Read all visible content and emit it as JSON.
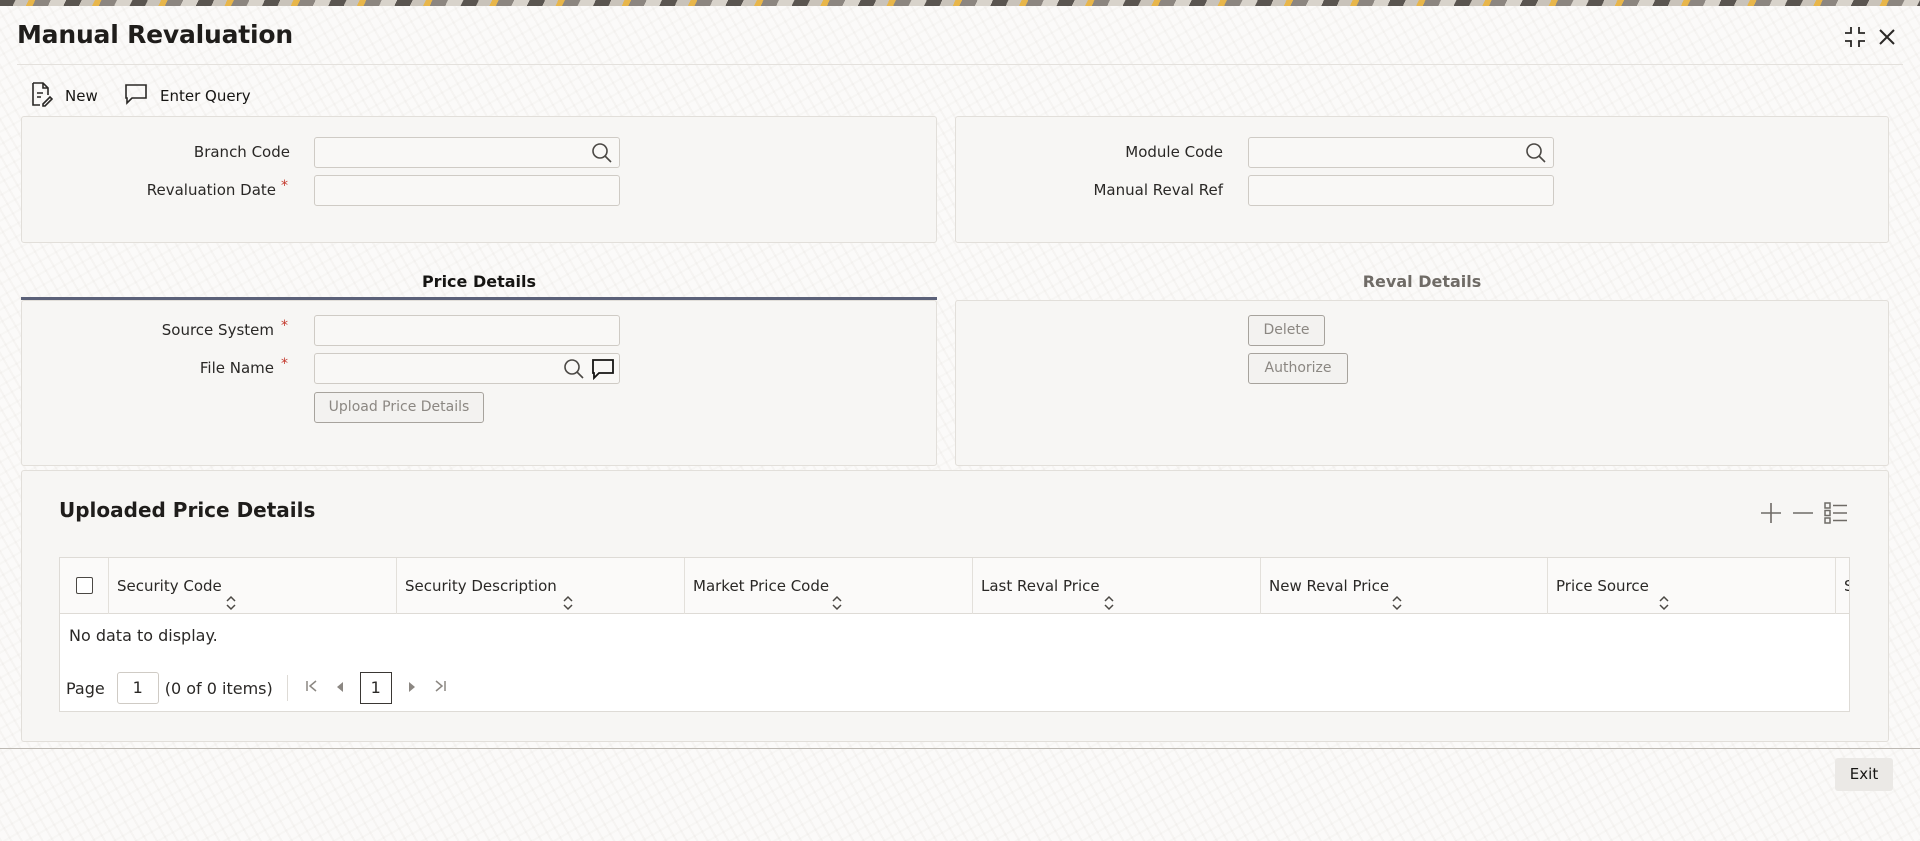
{
  "window": {
    "title": "Manual Revaluation"
  },
  "toolbar": {
    "new_label": "New",
    "enter_query_label": "Enter Query"
  },
  "header_panel": {
    "branch_code_label": "Branch Code",
    "branch_code_value": "",
    "revaluation_date_label": "Revaluation Date",
    "revaluation_date_value": "",
    "module_code_label": "Module Code",
    "module_code_value": "",
    "manual_reval_ref_label": "Manual Reval Ref",
    "manual_reval_ref_value": "",
    "required_marker": "*"
  },
  "tabs": [
    {
      "label": "Price Details",
      "active": true
    },
    {
      "label": "Reval Details",
      "active": false
    }
  ],
  "price_details": {
    "source_system_label": "Source System",
    "source_system_value": "",
    "file_name_label": "File Name",
    "file_name_value": "",
    "upload_button_label": "Upload Price Details"
  },
  "reval_details": {
    "delete_label": "Delete",
    "authorize_label": "Authorize"
  },
  "uploaded_grid": {
    "title": "Uploaded Price Details",
    "columns": [
      "Security Code",
      "Security Description",
      "Market Price Code",
      "Last Reval Price",
      "New Reval Price",
      "Price Source",
      "St"
    ],
    "empty_message": "No data to display.",
    "page_label": "Page",
    "page_input": "1",
    "items_text": "(0 of 0 items)",
    "current_page": "1"
  },
  "footer": {
    "exit_label": "Exit"
  },
  "colors": {
    "tab_underline": "#5b6179",
    "required": "#c3372a"
  }
}
